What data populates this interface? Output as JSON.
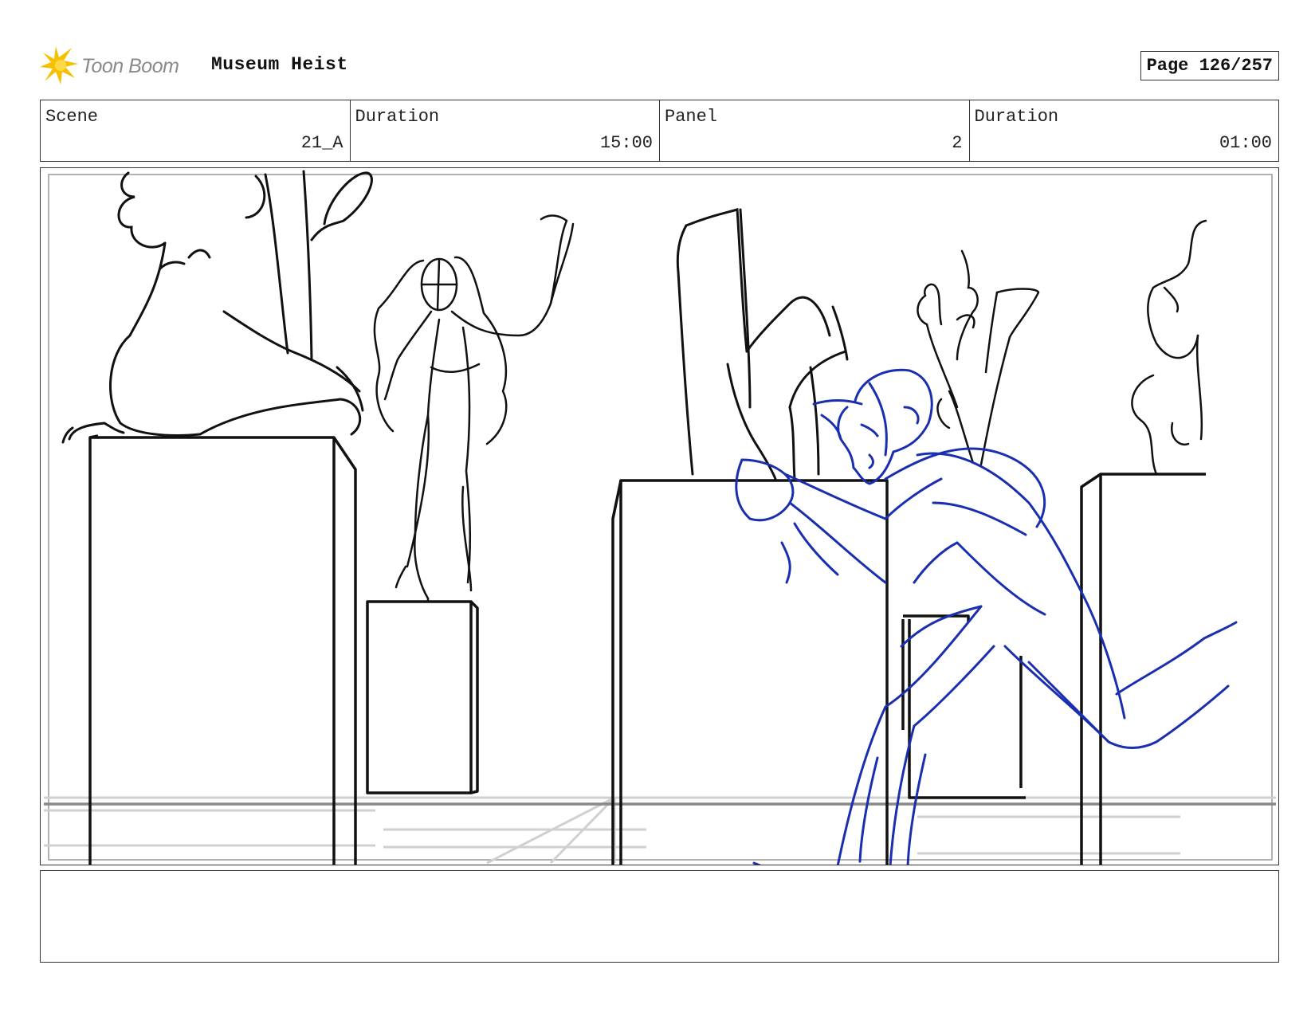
{
  "header": {
    "logo_text": "Toon Boom",
    "project_title": "Museum Heist",
    "page_label": "Page 126/257"
  },
  "info": [
    {
      "label": "Scene",
      "value": "21_A"
    },
    {
      "label": "Duration",
      "value": "15:00"
    },
    {
      "label": "Panel",
      "value": "2"
    },
    {
      "label": "Duration",
      "value": "01:00"
    }
  ],
  "notes": {
    "text": ""
  },
  "colors": {
    "sketch_black": "#111111",
    "sketch_blue": "#1a2fb0",
    "floor_grey": "#c8c8c8",
    "logo_yellow": "#f5c000"
  }
}
